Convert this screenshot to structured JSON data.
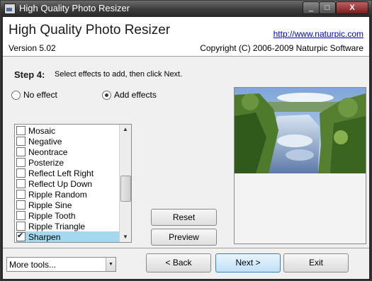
{
  "window": {
    "title": "High Quality Photo Resizer",
    "minimize_glyph": "_",
    "maximize_glyph": "□",
    "close_glyph": "X"
  },
  "header": {
    "app_name": "High Quality Photo Resizer",
    "version": "Version 5.02",
    "website": "http://www.naturpic.com",
    "copyright": "Copyright (C) 2006-2009 Naturpic Software"
  },
  "step": {
    "title": "Step 4:",
    "description": "Select effects to add, then click Next.",
    "options": [
      {
        "label": "No effect",
        "selected": false
      },
      {
        "label": "Add effects",
        "selected": true
      }
    ]
  },
  "effects": {
    "items": [
      {
        "label": "Mosaic",
        "checked": false,
        "selected": false
      },
      {
        "label": "Negative",
        "checked": false,
        "selected": false
      },
      {
        "label": "Neontrace",
        "checked": false,
        "selected": false
      },
      {
        "label": "Posterize",
        "checked": false,
        "selected": false
      },
      {
        "label": "Reflect Left Right",
        "checked": false,
        "selected": false
      },
      {
        "label": "Reflect Up Down",
        "checked": false,
        "selected": false
      },
      {
        "label": "Ripple Random",
        "checked": false,
        "selected": false
      },
      {
        "label": "Ripple Sine",
        "checked": false,
        "selected": false
      },
      {
        "label": "Ripple Tooth",
        "checked": false,
        "selected": false
      },
      {
        "label": "Ripple Triangle",
        "checked": false,
        "selected": false
      },
      {
        "label": "Sharpen",
        "checked": true,
        "selected": true
      }
    ]
  },
  "buttons": {
    "reset": "Reset",
    "preview": "Preview"
  },
  "footer": {
    "tools_label": "More tools...",
    "back": "< Back",
    "next": "Next >",
    "exit": "Exit"
  },
  "colors": {
    "selection": "#a4d8ee",
    "link": "#0000cc"
  }
}
